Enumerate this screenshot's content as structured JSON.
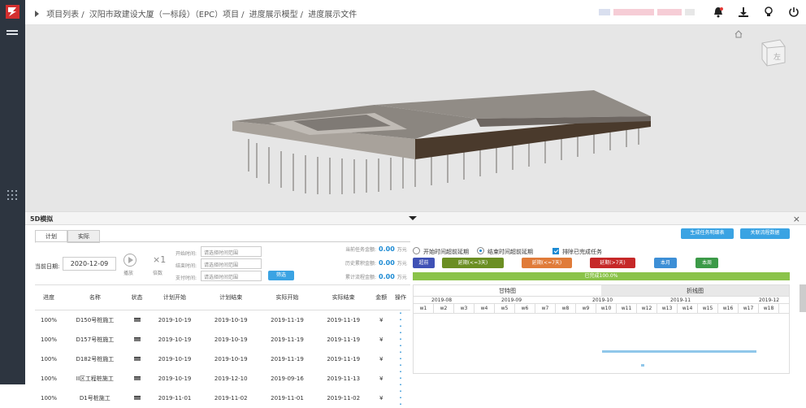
{
  "breadcrumb": {
    "items": [
      "项目列表",
      "汉阳市政建设大厦（一标段）（EPC）项目",
      "进度展示模型",
      "进度展示文件"
    ]
  },
  "topbar": {
    "icons": [
      "bell-icon",
      "download-icon",
      "lightbulb-icon",
      "power-icon"
    ]
  },
  "panel": {
    "title": "5D模拟",
    "tabs": [
      "计划",
      "实际"
    ],
    "current_date_label": "当前日期:",
    "current_date": "2020-12-09",
    "play_label": "播放",
    "speed_value": "×1",
    "speed_label": "倍数",
    "filters": [
      {
        "label": "开始时间:",
        "placeholder": "请选择时间范围"
      },
      {
        "label": "结束时间:",
        "placeholder": "请选择时间范围"
      },
      {
        "label": "支付时间:",
        "placeholder": "请选择时间范围"
      }
    ],
    "filter_button": "筛选",
    "money": [
      {
        "label": "当前任务金额:",
        "value": "0.00",
        "unit": "万元"
      },
      {
        "label": "历史累积金额:",
        "value": "0.00",
        "unit": "万元"
      },
      {
        "label": "累计流程金额:",
        "value": "0.00",
        "unit": "万元"
      }
    ],
    "radio_start": "开始时间超前延期",
    "radio_end": "结束时间超前延期",
    "checkbox_label": "排除已完成任务",
    "btn_generate": "生成任务明细表",
    "btn_related": "关联流程数据",
    "legend": [
      {
        "label": "超前",
        "color": "#3f51b5"
      },
      {
        "label": "延期(<=3天)",
        "color": "#6b8e23"
      },
      {
        "label": "延期(<=7天)",
        "color": "#e07b39"
      },
      {
        "label": "延期(>7天)",
        "color": "#c62828"
      },
      {
        "label": "本月",
        "color": "#3d8fd6"
      },
      {
        "label": "本周",
        "color": "#3c9a48"
      }
    ],
    "progress_label": "已完成100.0%",
    "progress_value": 1.0
  },
  "table": {
    "headers": [
      "进度",
      "名称",
      "状态",
      "计划开始",
      "计划结束",
      "实际开始",
      "实际结束",
      "金额",
      "操作"
    ],
    "rows": [
      [
        "100%",
        "D150号桩施工",
        "2019-10-19",
        "2019-10-19",
        "2019-11-19",
        "2019-11-19",
        "¥"
      ],
      [
        "100%",
        "D157号桩施工",
        "2019-10-19",
        "2019-10-19",
        "2019-11-19",
        "2019-11-19",
        "¥"
      ],
      [
        "100%",
        "D182号桩施工",
        "2019-10-19",
        "2019-10-19",
        "2019-11-19",
        "2019-11-19",
        "¥"
      ],
      [
        "100%",
        "II区工程桩施工",
        "2019-10-19",
        "2019-12-10",
        "2019-09-16",
        "2019-11-13",
        "¥"
      ],
      [
        "100%",
        "D1号桩施工",
        "2019-11-01",
        "2019-11-02",
        "2019-11-01",
        "2019-11-02",
        "¥"
      ]
    ]
  },
  "gantt": {
    "tab_gantt": "甘特图",
    "tab_line": "折线图",
    "months": [
      "2019-08",
      "2019-09",
      "2019-10",
      "2019-11",
      "2019-12"
    ],
    "weeks": [
      "w1",
      "w2",
      "w3",
      "w4",
      "w5",
      "w6",
      "w7",
      "w8",
      "w9",
      "w10",
      "w11",
      "w12",
      "w13",
      "w14",
      "w15",
      "w16",
      "w17",
      "w18"
    ]
  }
}
